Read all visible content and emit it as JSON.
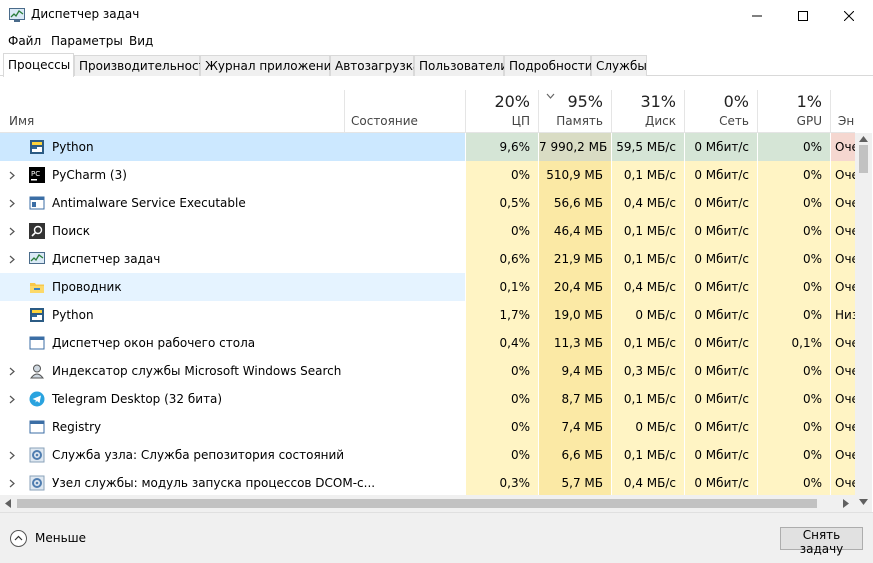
{
  "window": {
    "title": "Диспетчер задач"
  },
  "menu": [
    "Файл",
    "Параметры",
    "Вид"
  ],
  "tabs": [
    "Процессы",
    "Производительность",
    "Журнал приложений",
    "Автозагрузка",
    "Пользователи",
    "Подробности",
    "Службы"
  ],
  "header": {
    "name": "Имя",
    "state": "Состояние",
    "columns": [
      {
        "pct": "20%",
        "label": "ЦП"
      },
      {
        "pct": "95%",
        "label": "Память"
      },
      {
        "pct": "31%",
        "label": "Диск"
      },
      {
        "pct": "0%",
        "label": "Сеть"
      },
      {
        "pct": "1%",
        "label": "GPU"
      },
      {
        "pct": "",
        "label": "Энерг"
      }
    ]
  },
  "rows": [
    {
      "name": "Python",
      "icon": "python-icon",
      "expandable": false,
      "cpu": "9,6%",
      "mem": "7 990,2 МБ",
      "disk": "59,5 МБ/с",
      "net": "0 Мбит/с",
      "gpu": "0%",
      "energy": "Оче",
      "state": "selected"
    },
    {
      "name": "PyCharm (3)",
      "icon": "pycharm-icon",
      "expandable": true,
      "cpu": "0%",
      "mem": "510,9 МБ",
      "disk": "0,1 МБ/с",
      "net": "0 Мбит/с",
      "gpu": "0%",
      "energy": "Оче",
      "state": ""
    },
    {
      "name": "Antimalware Service Executable",
      "icon": "service-icon",
      "expandable": true,
      "cpu": "0,5%",
      "mem": "56,6 МБ",
      "disk": "0,4 МБ/с",
      "net": "0 Мбит/с",
      "gpu": "0%",
      "energy": "Оче",
      "state": ""
    },
    {
      "name": "Поиск",
      "icon": "search-icon",
      "expandable": true,
      "cpu": "0%",
      "mem": "46,4 МБ",
      "disk": "0,1 МБ/с",
      "net": "0 Мбит/с",
      "gpu": "0%",
      "energy": "Оче",
      "state": ""
    },
    {
      "name": "Диспетчер задач",
      "icon": "task-manager-icon",
      "expandable": true,
      "cpu": "0,6%",
      "mem": "21,9 МБ",
      "disk": "0,1 МБ/с",
      "net": "0 Мбит/с",
      "gpu": "0%",
      "energy": "Оче",
      "state": ""
    },
    {
      "name": "Проводник",
      "icon": "explorer-folder-icon",
      "expandable": false,
      "cpu": "0,1%",
      "mem": "20,4 МБ",
      "disk": "0,4 МБ/с",
      "net": "0 Мбит/с",
      "gpu": "0%",
      "energy": "Оче",
      "state": "hover"
    },
    {
      "name": "Python",
      "icon": "python-icon",
      "expandable": false,
      "cpu": "1,7%",
      "mem": "19,0 МБ",
      "disk": "0 МБ/с",
      "net": "0 Мбит/с",
      "gpu": "0%",
      "energy": "Низ",
      "state": ""
    },
    {
      "name": "Диспетчер окон рабочего стола",
      "icon": "window-icon",
      "expandable": false,
      "cpu": "0,4%",
      "mem": "11,3 МБ",
      "disk": "0,1 МБ/с",
      "net": "0 Мбит/с",
      "gpu": "0,1%",
      "energy": "Оче",
      "state": ""
    },
    {
      "name": "Индексатор службы Microsoft Windows Search",
      "icon": "indexer-user-icon",
      "expandable": true,
      "cpu": "0%",
      "mem": "9,4 МБ",
      "disk": "0,3 МБ/с",
      "net": "0 Мбит/с",
      "gpu": "0%",
      "energy": "Оче",
      "state": ""
    },
    {
      "name": "Telegram Desktop (32 бита)",
      "icon": "telegram-icon",
      "expandable": true,
      "cpu": "0%",
      "mem": "8,7 МБ",
      "disk": "0,1 МБ/с",
      "net": "0 Мбит/с",
      "gpu": "0%",
      "energy": "Оче",
      "state": ""
    },
    {
      "name": "Registry",
      "icon": "window-icon",
      "expandable": false,
      "cpu": "0%",
      "mem": "7,4 МБ",
      "disk": "0 МБ/с",
      "net": "0 Мбит/с",
      "gpu": "0%",
      "energy": "Оче",
      "state": ""
    },
    {
      "name": "Служба узла: Служба репозитория состояний",
      "icon": "gear-icon",
      "expandable": true,
      "cpu": "0%",
      "mem": "6,6 МБ",
      "disk": "0,1 МБ/с",
      "net": "0 Мбит/с",
      "gpu": "0%",
      "energy": "Оче",
      "state": ""
    },
    {
      "name": "Узел службы: модуль запуска процессов DCOM-с...",
      "icon": "gear-icon",
      "expandable": true,
      "cpu": "0,3%",
      "mem": "5,7 МБ",
      "disk": "0,4 МБ/с",
      "net": "0 Мбит/с",
      "gpu": "0%",
      "energy": "Оче",
      "state": ""
    }
  ],
  "footer": {
    "less": "Меньше",
    "end_task": "Снять задачу"
  },
  "colors": {
    "heat_light": "#fff4c4",
    "heat_mem": "#fbe9a5",
    "selected": "#cce8ff",
    "hover": "#e5f3ff",
    "energy_hot": "#f5d7d0"
  }
}
